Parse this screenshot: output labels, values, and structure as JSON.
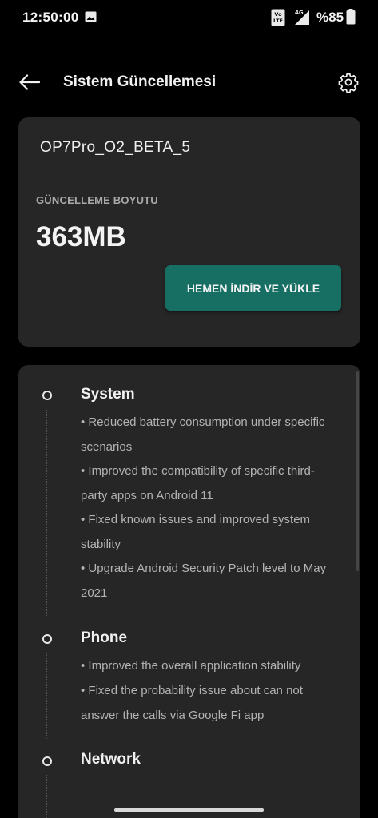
{
  "status_bar": {
    "time": "12:50:00",
    "battery": "%85",
    "volte_label": "Vo LTE",
    "network_label": "4G",
    "icons": [
      "gallery-icon",
      "volte-icon",
      "signal-icon",
      "battery-icon"
    ]
  },
  "header": {
    "title": "Sistem Güncellemesi",
    "icons": [
      "back-arrow-icon",
      "gear-icon"
    ]
  },
  "update": {
    "build_name": "OP7Pro_O2_BETA_5",
    "size_label": "GÜNCELLEME BOYUTU",
    "size_value": "363MB",
    "download_button": "HEMEN İNDİR VE YÜKLE"
  },
  "changelog": {
    "sections": [
      {
        "title": "System",
        "items": [
          "• Reduced battery consumption under specific scenarios",
          "• Improved the compatibility of specific third-party apps on Android 11",
          "• Fixed known issues and improved system stability",
          "• Upgrade Android Security Patch level to May 2021"
        ]
      },
      {
        "title": "Phone",
        "items": [
          "• Improved the overall application stability",
          "• Fixed the probability issue about can not answer the calls via Google Fi app"
        ]
      },
      {
        "title": "Network",
        "items": []
      }
    ]
  },
  "colors": {
    "background": "#000000",
    "card": "#262626",
    "accent_button": "#176f64",
    "secondary_text": "#b3b3b3"
  }
}
